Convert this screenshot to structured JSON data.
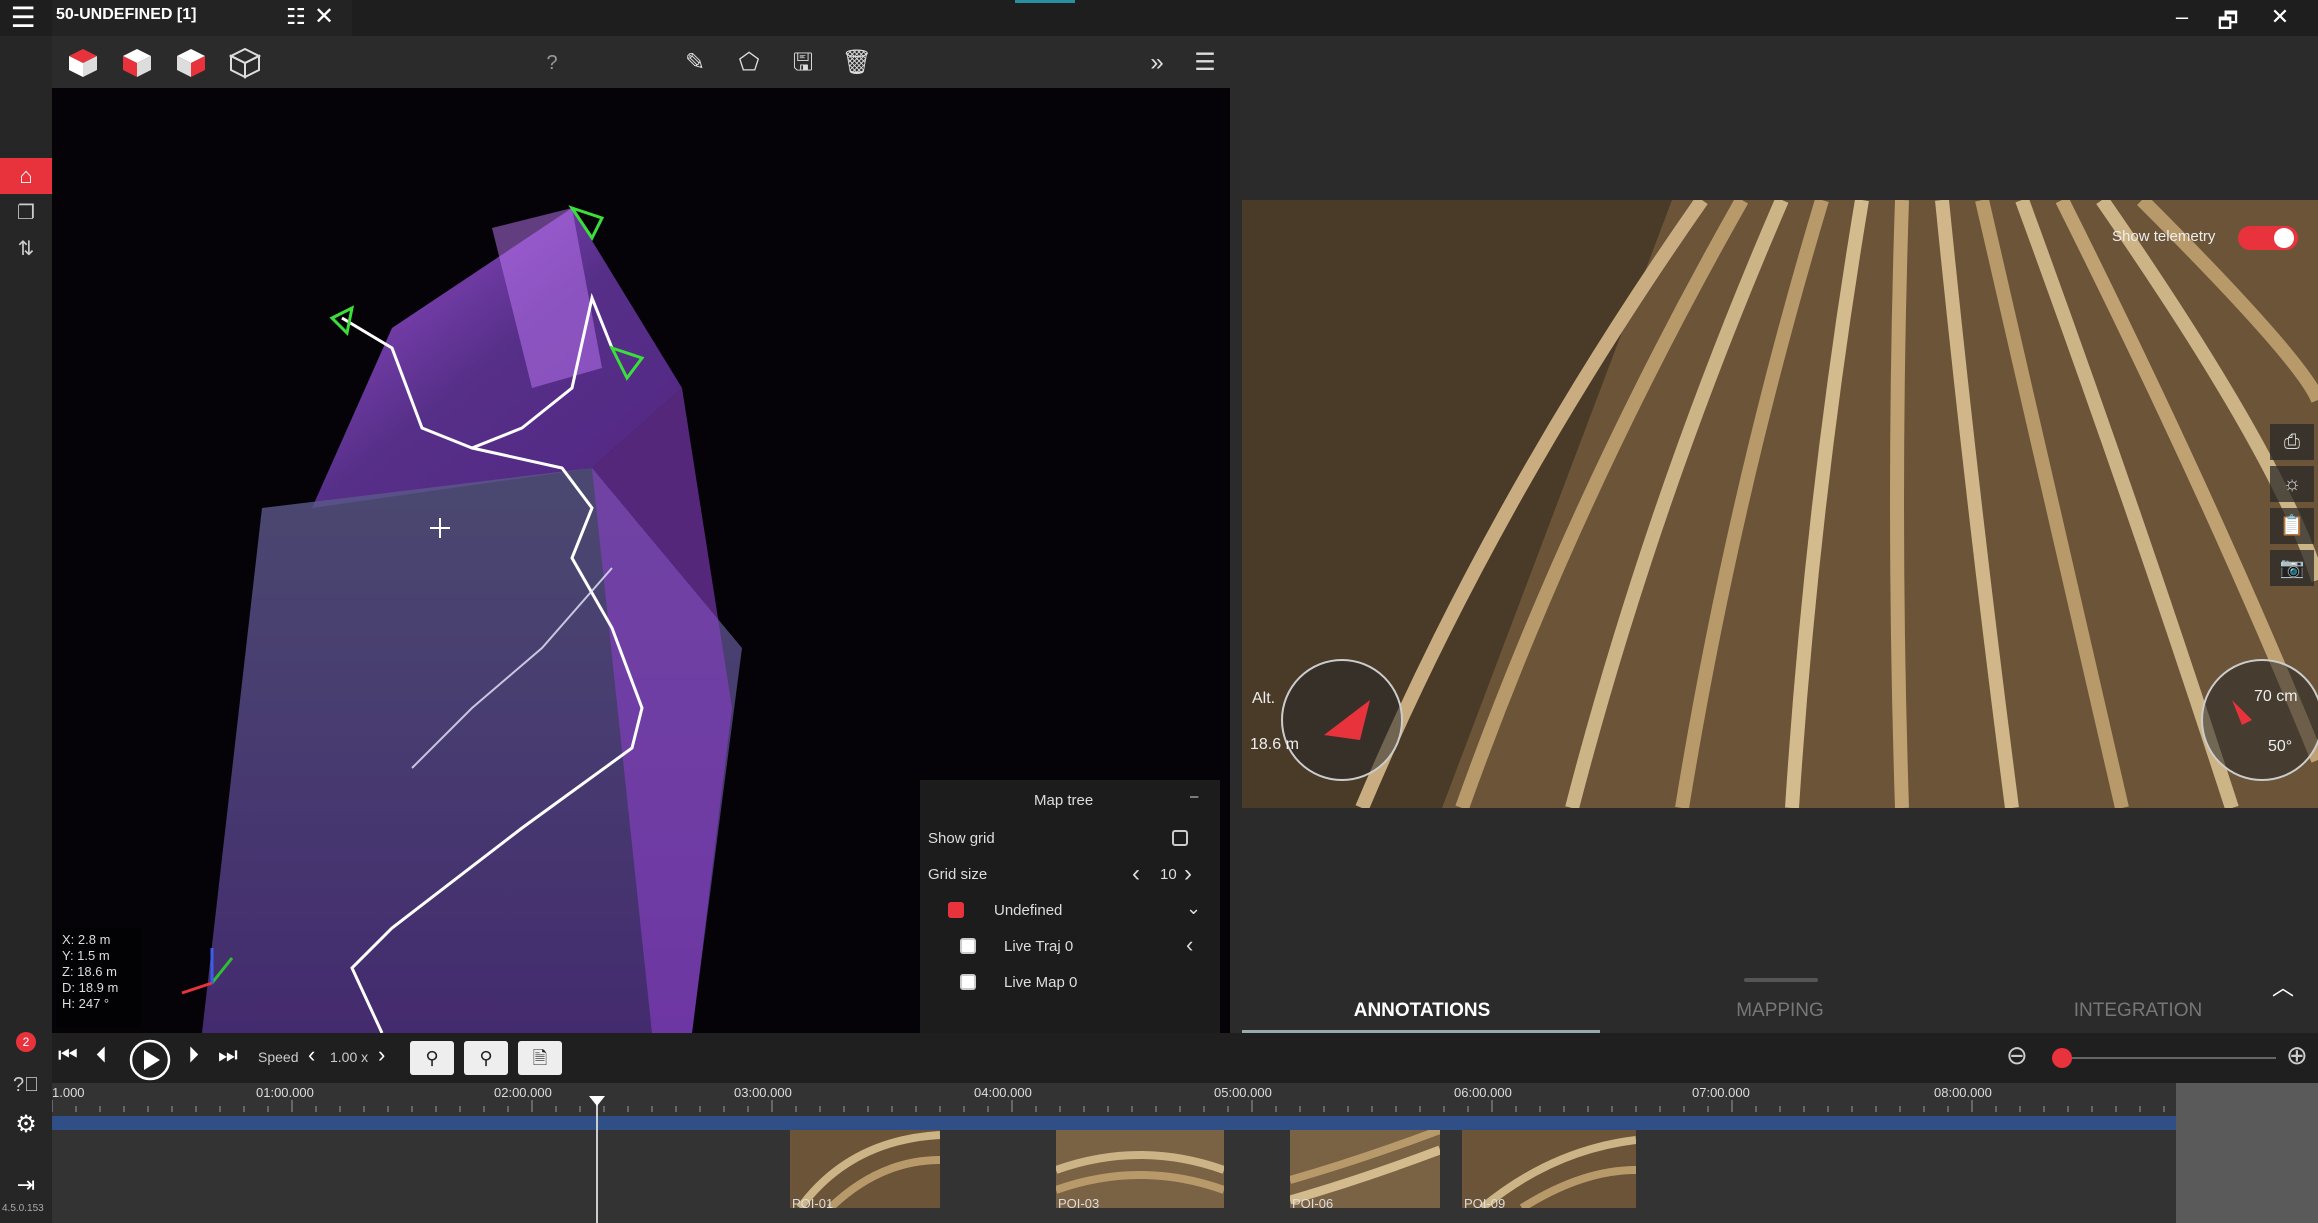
{
  "window": {
    "doc_title": "50-UNDEFINED [1]",
    "minimize": "–",
    "restore": "🗗",
    "close": "✕"
  },
  "sidebar": {
    "notifications_count": "2",
    "version": "4.5.0.153"
  },
  "toolbar": {
    "help": "?"
  },
  "viewport": {
    "coords": [
      "X: 2.8 m",
      "Y: 1.5 m",
      "Z: 18.6 m",
      "D: 18.9 m",
      "H: 247 °"
    ]
  },
  "map_tree": {
    "title": "Map tree",
    "collapse": "–",
    "show_grid_label": "Show grid",
    "grid_size_label": "Grid size",
    "grid_size_value": "10",
    "layers": [
      {
        "label": "Undefined"
      },
      {
        "label": "Live Traj 0"
      },
      {
        "label": "Live Map 0"
      }
    ]
  },
  "camera": {
    "show_telemetry_label": "Show telemetry",
    "alt_label": "Alt.",
    "alt_value": "18.6 m",
    "distance_value": "70 cm",
    "angle_value": "50°"
  },
  "tabs": [
    {
      "label": "ANNOTATIONS",
      "active": true
    },
    {
      "label": "MAPPING",
      "active": false
    },
    {
      "label": "INTEGRATION",
      "active": false
    }
  ],
  "playback": {
    "speed_label": "Speed",
    "speed_value": "1.00 x"
  },
  "timeline": {
    "ticks": [
      "1.000",
      "01:00.000",
      "02:00.000",
      "03:00.000",
      "04:00.000",
      "05:00.000",
      "06:00.000",
      "07:00.000",
      "08:00.000"
    ],
    "pois": [
      "POI-01",
      "POI-03",
      "POI-06",
      "POI-09"
    ]
  },
  "colors": {
    "accent": "#e8323c",
    "track": "#2f4f86",
    "pointcloud": "#8a3fc6"
  }
}
